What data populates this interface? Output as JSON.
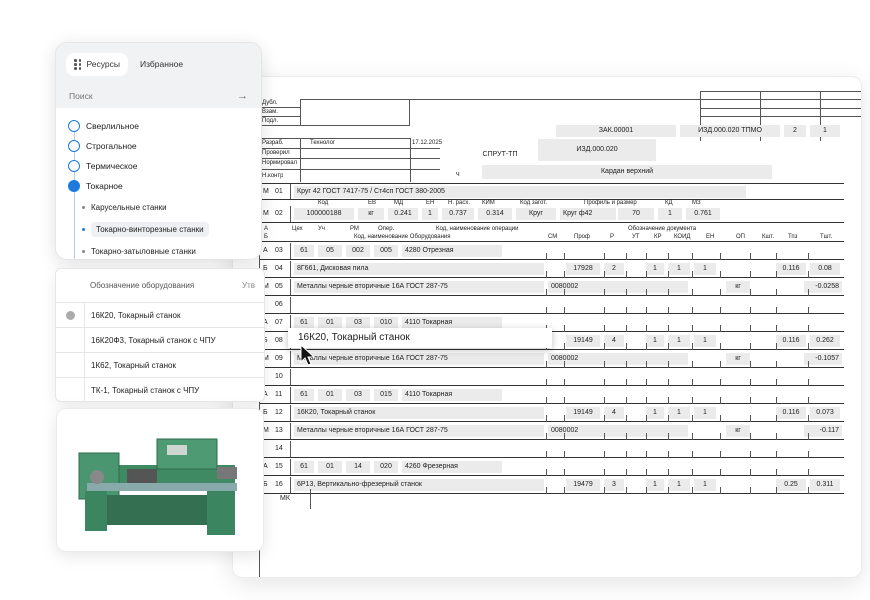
{
  "sidebar": {
    "tab_resources": "Ресурсы",
    "tab_favorites": "Избранное",
    "search_placeholder": "Поиск",
    "tree": [
      "Сверлильное",
      "Строгальное",
      "Термическое",
      "Токарное"
    ],
    "subitems": [
      "Карусельные станки",
      "Токарно-винторезные станки",
      "Токарно-затыловные станки"
    ]
  },
  "equipment": {
    "header": "Обозначение оборудования",
    "header_right": "Утв",
    "rows": [
      "16К20, Токарный станок",
      "16К20Ф3, Токарный станок с ЧПУ",
      "1К62, Токарный станок",
      "ТК-1, Токарный станок с ЧПУ"
    ]
  },
  "doc": {
    "stamp": [
      "Дубл.",
      "Взам.",
      "Подл."
    ],
    "title_block": {
      "zak": "ЗАК.00001",
      "izd": "ИЗД.000.020 ТПМО",
      "sheet": "2",
      "sheets": "1",
      "razrab": "Разраб.",
      "proveril": "Проверил",
      "normir": "Нормировал",
      "nkontr": "Н.контр",
      "role": "Технолог",
      "date": "17.12.2025",
      "system": "СПРУТ-ТП",
      "izd2": "ИЗД.000.020",
      "ch": "ч",
      "part": "Кардан верхний"
    },
    "m01": {
      "letter": "М",
      "num": "01",
      "text": "Круг 42 ГОСТ 7417-75 / Ст4сп ГОСТ 380-2005"
    },
    "m02_headers": [
      "Код",
      "ЕВ",
      "МД",
      "ЕН",
      "Н. расх.",
      "КИМ",
      "Код загот.",
      "Профиль и размер",
      "КД",
      "МЗ"
    ],
    "m02": {
      "letter": "М",
      "num": "02",
      "values": [
        "100000188",
        "кг",
        "0.241",
        "1",
        "0.737",
        "0.314",
        "Круг",
        "Круг ф42",
        "70",
        "1",
        "0.761"
      ]
    },
    "hdr_a": [
      "А",
      "Цех",
      "Уч",
      "РМ",
      "Опер.",
      "Код, наименование операции",
      "Обозначение документа"
    ],
    "hdr_b": [
      "Б",
      "Код, наименование Оборудования",
      "СМ",
      "Проф",
      "Р",
      "УТ",
      "КР",
      "КОИД",
      "ЕН",
      "ОП",
      "Кшт.",
      "Тпз",
      "Тшт."
    ],
    "rows": [
      {
        "l": "А",
        "n": "03",
        "a": [
          "61",
          "05",
          "002",
          "005",
          "4280 Отрезная"
        ]
      },
      {
        "l": "Б",
        "n": "04",
        "text": "8Г661, Дисковая пила",
        "prof": "17928",
        "r": "2",
        "kr": "1",
        "koid": "1",
        "en": "1",
        "tpz": "0.116",
        "tsht": "0.08"
      },
      {
        "l": "М",
        "n": "05",
        "text": "Металлы черные вторичные 16А ГОСТ 287-75",
        "code": "0080002",
        "unit": "кг",
        "val": "-0.0258"
      },
      {
        "l": "",
        "n": "06"
      },
      {
        "l": "А",
        "n": "07",
        "a": [
          "61",
          "01",
          "03",
          "010",
          "4110 Токарная"
        ]
      },
      {
        "l": "Б",
        "n": "08",
        "text": "16К20, Токарный станок",
        "prof": "19149",
        "r": "4",
        "kr": "1",
        "koid": "1",
        "en": "1",
        "tpz": "0.116",
        "tsht": "0.262"
      },
      {
        "l": "М",
        "n": "09",
        "text": "Металлы черные вторичные 16А ГОСТ 287-75",
        "code": "0080002",
        "unit": "кг",
        "val": "-0.1057"
      },
      {
        "l": "",
        "n": "10"
      },
      {
        "l": "А",
        "n": "11",
        "a": [
          "61",
          "01",
          "03",
          "015",
          "4110 Токарная"
        ]
      },
      {
        "l": "Б",
        "n": "12",
        "text": "16К20, Токарный станок",
        "prof": "19149",
        "r": "4",
        "kr": "1",
        "koid": "1",
        "en": "1",
        "tpz": "0.116",
        "tsht": "0.073"
      },
      {
        "l": "М",
        "n": "13",
        "text": "Металлы черные вторичные 16А ГОСТ 287-75",
        "code": "0080002",
        "unit": "кг",
        "val": "-0.117"
      },
      {
        "l": "",
        "n": "14"
      },
      {
        "l": "А",
        "n": "15",
        "a": [
          "61",
          "01",
          "14",
          "020",
          "4260 Фрезерная"
        ]
      },
      {
        "l": "Б",
        "n": "16",
        "text": "6Р13, Вертикально-фрезерный станок",
        "prof": "19479",
        "r": "3",
        "kr": "1",
        "koid": "1",
        "en": "1",
        "tpz": "0.25",
        "tsht": "0.311"
      }
    ],
    "mk": "МК"
  },
  "tooltip": "16К20, Токарный станок",
  "colors": {
    "accent": "#1f7ae0",
    "field": "#ebebeb",
    "machine": "#3f8a62"
  }
}
